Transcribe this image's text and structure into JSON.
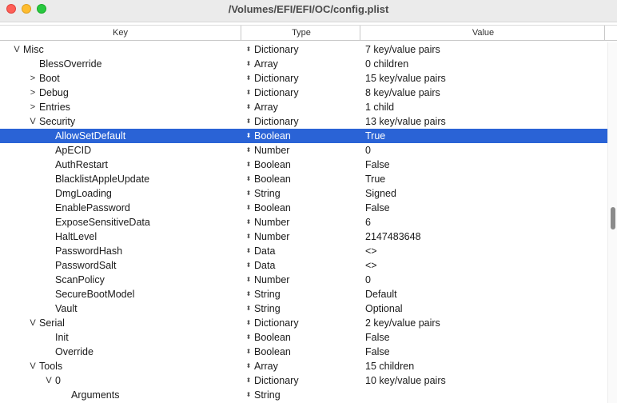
{
  "window": {
    "title": "/Volumes/EFI/EFI/OC/config.plist"
  },
  "columns": {
    "key": "Key",
    "type": "Type",
    "value": "Value"
  },
  "glyphs": {
    "expanded": "V",
    "collapsed": ">",
    "stepper": "⬍"
  },
  "rows": [
    {
      "key": "Misc",
      "type": "Dictionary",
      "value": "7 key/value pairs",
      "state": "expanded",
      "depth": 1
    },
    {
      "key": "BlessOverride",
      "type": "Array",
      "value": "0 children",
      "state": "none",
      "depth": 2
    },
    {
      "key": "Boot",
      "type": "Dictionary",
      "value": "15 key/value pairs",
      "state": "collapsed",
      "depth": 2
    },
    {
      "key": "Debug",
      "type": "Dictionary",
      "value": "8 key/value pairs",
      "state": "collapsed",
      "depth": 2
    },
    {
      "key": "Entries",
      "type": "Array",
      "value": "1 child",
      "state": "collapsed",
      "depth": 2
    },
    {
      "key": "Security",
      "type": "Dictionary",
      "value": "13 key/value pairs",
      "state": "expanded",
      "depth": 2
    },
    {
      "key": "AllowSetDefault",
      "type": "Boolean",
      "value": "True",
      "state": "none",
      "depth": 3,
      "selected": true
    },
    {
      "key": "ApECID",
      "type": "Number",
      "value": "0",
      "state": "none",
      "depth": 3
    },
    {
      "key": "AuthRestart",
      "type": "Boolean",
      "value": "False",
      "state": "none",
      "depth": 3
    },
    {
      "key": "BlacklistAppleUpdate",
      "type": "Boolean",
      "value": "True",
      "state": "none",
      "depth": 3
    },
    {
      "key": "DmgLoading",
      "type": "String",
      "value": "Signed",
      "state": "none",
      "depth": 3
    },
    {
      "key": "EnablePassword",
      "type": "Boolean",
      "value": "False",
      "state": "none",
      "depth": 3
    },
    {
      "key": "ExposeSensitiveData",
      "type": "Number",
      "value": "6",
      "state": "none",
      "depth": 3
    },
    {
      "key": "HaltLevel",
      "type": "Number",
      "value": "2147483648",
      "state": "none",
      "depth": 3
    },
    {
      "key": "PasswordHash",
      "type": "Data",
      "value": "<>",
      "state": "none",
      "depth": 3
    },
    {
      "key": "PasswordSalt",
      "type": "Data",
      "value": "<>",
      "state": "none",
      "depth": 3
    },
    {
      "key": "ScanPolicy",
      "type": "Number",
      "value": "0",
      "state": "none",
      "depth": 3
    },
    {
      "key": "SecureBootModel",
      "type": "String",
      "value": "Default",
      "state": "none",
      "depth": 3
    },
    {
      "key": "Vault",
      "type": "String",
      "value": "Optional",
      "state": "none",
      "depth": 3
    },
    {
      "key": "Serial",
      "type": "Dictionary",
      "value": "2 key/value pairs",
      "state": "expanded",
      "depth": 2
    },
    {
      "key": "Init",
      "type": "Boolean",
      "value": "False",
      "state": "none",
      "depth": 3
    },
    {
      "key": "Override",
      "type": "Boolean",
      "value": "False",
      "state": "none",
      "depth": 3
    },
    {
      "key": "Tools",
      "type": "Array",
      "value": "15 children",
      "state": "expanded",
      "depth": 2
    },
    {
      "key": "0",
      "type": "Dictionary",
      "value": "10 key/value pairs",
      "state": "expanded",
      "depth": 3
    },
    {
      "key": "Arguments",
      "type": "String",
      "value": "",
      "state": "none",
      "depth": 4
    }
  ],
  "colors": {
    "selection": "#2a63d6",
    "close": "#fe5f57",
    "minimize": "#febc2e",
    "maximize": "#28c840"
  }
}
